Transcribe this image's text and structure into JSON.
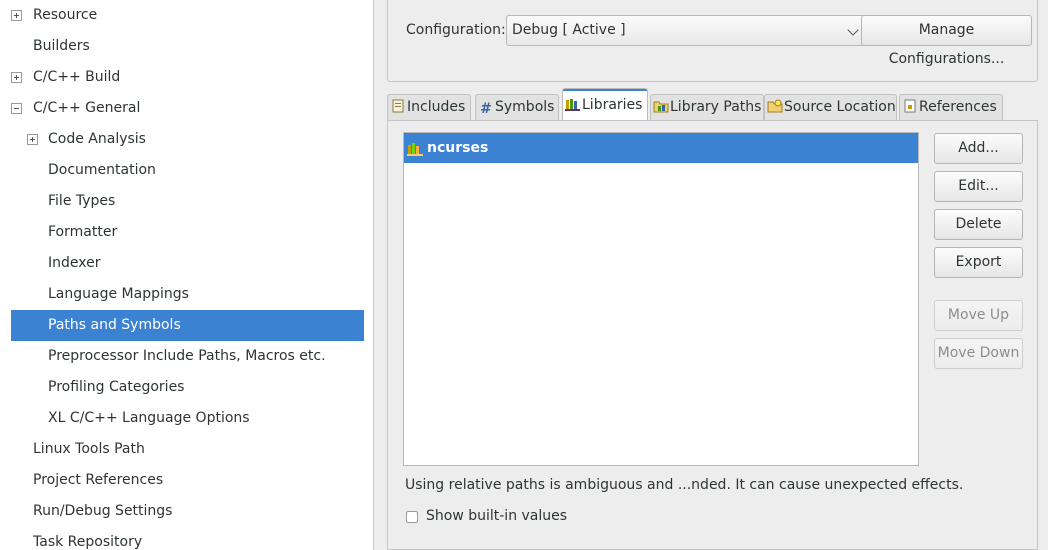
{
  "tree": {
    "items": [
      {
        "label": "Resource",
        "expander": "plus"
      },
      {
        "label": "Builders",
        "expander": ""
      },
      {
        "label": "C/C++ Build",
        "expander": "plus"
      },
      {
        "label": "C/C++ General",
        "expander": "minus"
      },
      {
        "label": "Code Analysis",
        "expander": "plus"
      },
      {
        "label": "Documentation",
        "expander": ""
      },
      {
        "label": "File Types",
        "expander": ""
      },
      {
        "label": "Formatter",
        "expander": ""
      },
      {
        "label": "Indexer",
        "expander": ""
      },
      {
        "label": "Language Mappings",
        "expander": ""
      },
      {
        "label": "Paths and Symbols",
        "expander": "",
        "selected": true
      },
      {
        "label": "Preprocessor Include Paths, Macros etc.",
        "expander": ""
      },
      {
        "label": "Profiling Categories",
        "expander": ""
      },
      {
        "label": "XL C/C++ Language Options",
        "expander": ""
      },
      {
        "label": "Linux Tools Path",
        "expander": ""
      },
      {
        "label": "Project References",
        "expander": ""
      },
      {
        "label": "Run/Debug Settings",
        "expander": ""
      },
      {
        "label": "Task Repository",
        "expander": ""
      }
    ]
  },
  "config": {
    "label": "Configuration:",
    "value": "Debug  [ Active ]",
    "manage_button": "Manage Configurations..."
  },
  "tabs": [
    {
      "label": "Includes",
      "icon": "includes-icon"
    },
    {
      "label": "Symbols",
      "icon": "hash-icon"
    },
    {
      "label": "Libraries",
      "icon": "library-icon",
      "active": true
    },
    {
      "label": "Library Paths",
      "icon": "library-path-icon"
    },
    {
      "label": "Source Location",
      "icon": "folder-icon"
    },
    {
      "label": "References",
      "icon": "references-icon"
    }
  ],
  "libraries": {
    "items": [
      "ncurses"
    ],
    "buttons": {
      "add": "Add...",
      "edit": "Edit...",
      "delete": "Delete",
      "export": "Export",
      "move_up": "Move Up",
      "move_down": "Move Down"
    }
  },
  "warning_text": "Using relative paths is ambiguous and ...nded. It can cause unexpected effects.",
  "show_builtin_label": "Show built-in values",
  "colors": {
    "selection": "#3c82d2",
    "window_bg": "#ededed"
  }
}
